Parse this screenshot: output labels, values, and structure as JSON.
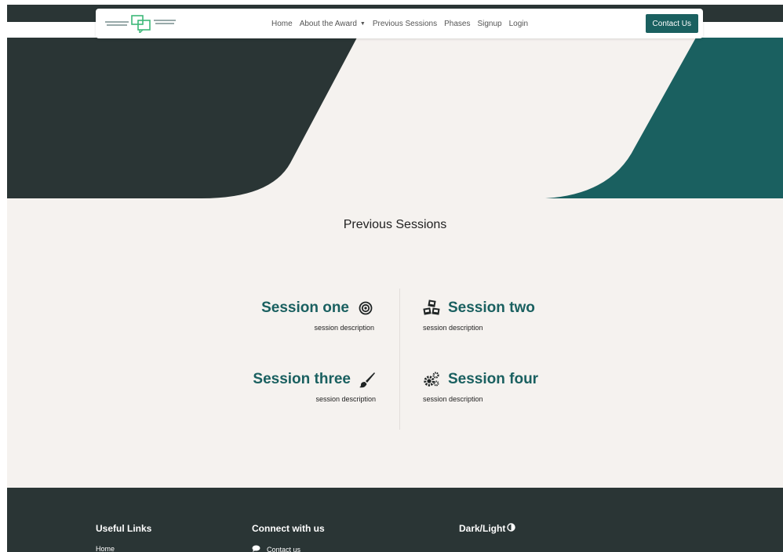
{
  "nav": {
    "links": [
      {
        "label": "Home"
      },
      {
        "label": "About the Award"
      },
      {
        "label": "Previous Sessions"
      },
      {
        "label": "Phases"
      },
      {
        "label": "Signup"
      },
      {
        "label": "Login"
      }
    ],
    "contact_button": "Contact Us"
  },
  "sections": {
    "title": "Previous Sessions",
    "sessions": [
      {
        "title": "Session one",
        "description": "session description",
        "icon": "target-icon"
      },
      {
        "title": "Session two",
        "description": "session description",
        "icon": "cubes-icon"
      },
      {
        "title": "Session three",
        "description": "session description",
        "icon": "paint-brush-icon"
      },
      {
        "title": "Session four",
        "description": "session description",
        "icon": "cogs-icon"
      }
    ]
  },
  "footer": {
    "useful_links_title": "Useful Links",
    "useful_links": [
      "Home"
    ],
    "connect_title": "Connect with us",
    "connect_links": [
      "Contact us"
    ],
    "theme_toggle_label": "Dark/Light"
  },
  "colors": {
    "dark": "#2a3535",
    "accent": "#1a6060",
    "light_bg": "#f5f2ef"
  }
}
